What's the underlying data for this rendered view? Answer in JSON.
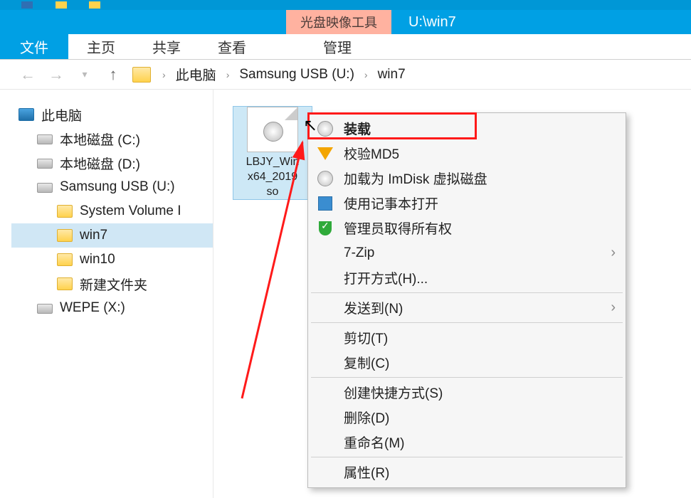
{
  "titlebar": {
    "tool_tab": "光盘映像工具",
    "window_title": "U:\\win7"
  },
  "ribbon": {
    "file": "文件",
    "tabs": [
      "主页",
      "共享",
      "查看"
    ],
    "context_tab": "管理"
  },
  "breadcrumb": {
    "items": [
      "此电脑",
      "Samsung USB (U:)",
      "win7"
    ]
  },
  "tree": {
    "root": "此电脑",
    "nodes": [
      {
        "label": "本地磁盘 (C:)",
        "icon": "drive"
      },
      {
        "label": "本地磁盘 (D:)",
        "icon": "drive"
      },
      {
        "label": "Samsung USB (U:)",
        "icon": "drive",
        "expanded": true,
        "children": [
          {
            "label": "System Volume I",
            "icon": "folder"
          },
          {
            "label": "win7",
            "icon": "folder",
            "selected": true
          },
          {
            "label": "win10",
            "icon": "folder"
          },
          {
            "label": "新建文件夹",
            "icon": "folder"
          }
        ]
      },
      {
        "label": "WEPE (X:)",
        "icon": "drive"
      }
    ]
  },
  "content": {
    "file": {
      "name_line1": "LBJY_Win",
      "name_line2": "x64_2019",
      "name_line3": "so"
    }
  },
  "context_menu": {
    "items": [
      {
        "icon": "disc",
        "label": "装载",
        "bold": true
      },
      {
        "icon": "shield-y",
        "label": "校验MD5"
      },
      {
        "icon": "disc",
        "label": "加载为 ImDisk 虚拟磁盘"
      },
      {
        "icon": "note",
        "label": "使用记事本打开"
      },
      {
        "icon": "shield-g",
        "label": "管理员取得所有权"
      },
      {
        "label": "7-Zip",
        "submenu": true
      },
      {
        "label": "打开方式(H)..."
      },
      {
        "sep": true
      },
      {
        "label": "发送到(N)",
        "submenu": true
      },
      {
        "sep": true
      },
      {
        "label": "剪切(T)"
      },
      {
        "label": "复制(C)"
      },
      {
        "sep": true
      },
      {
        "label": "创建快捷方式(S)"
      },
      {
        "label": "删除(D)"
      },
      {
        "label": "重命名(M)"
      },
      {
        "sep": true
      },
      {
        "label": "属性(R)"
      }
    ]
  }
}
